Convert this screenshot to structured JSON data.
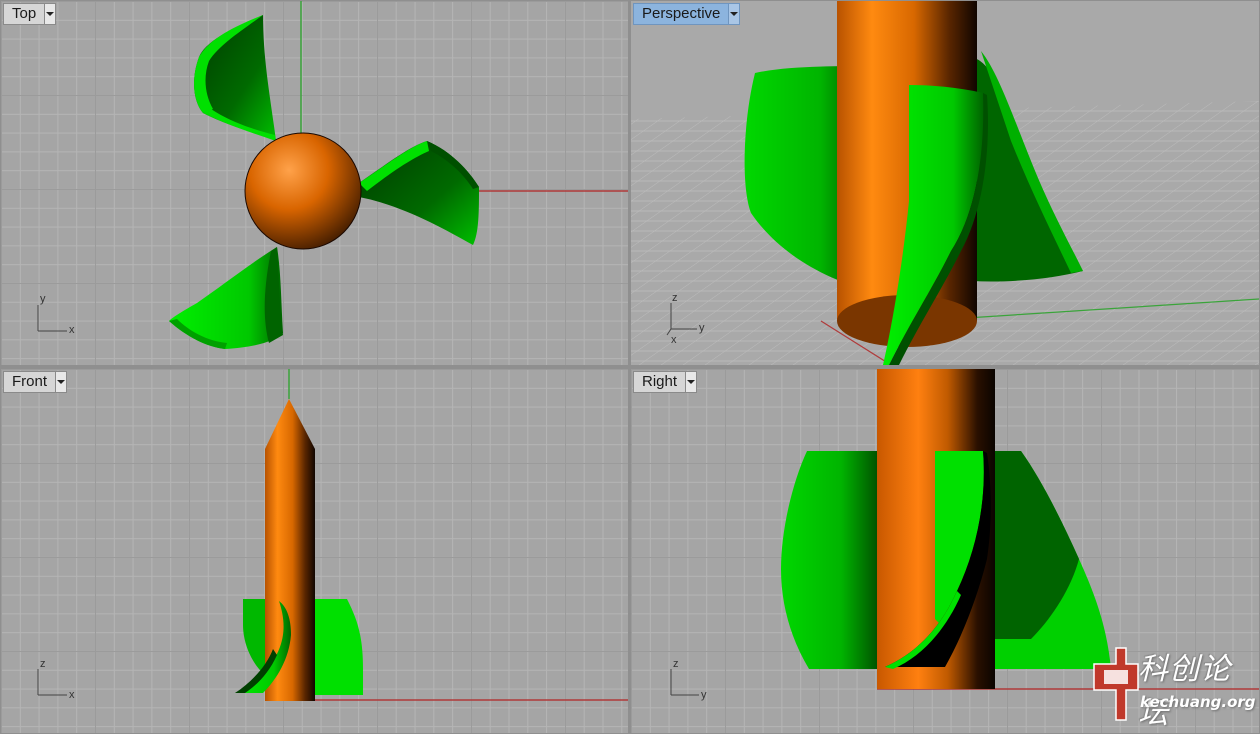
{
  "viewports": {
    "top": {
      "label": "Top",
      "axis_h": "x",
      "axis_v": "y"
    },
    "perspective": {
      "label": "Perspective",
      "axis_h": "y",
      "axis_v": "z",
      "axis_d": "x"
    },
    "front": {
      "label": "Front",
      "axis_h": "x",
      "axis_v": "z"
    },
    "right": {
      "label": "Right",
      "axis_h": "y",
      "axis_v": "z"
    }
  },
  "watermark": {
    "title": "科创论坛",
    "url": "kechuang.org"
  },
  "colors": {
    "orange": "#e06c00",
    "green": "#00e000",
    "grid_bg": "#a5a5a5",
    "active_tab": "#8cb4de",
    "world_x_axis": "#b03a3a",
    "world_y_axis": "#3aa43a"
  }
}
